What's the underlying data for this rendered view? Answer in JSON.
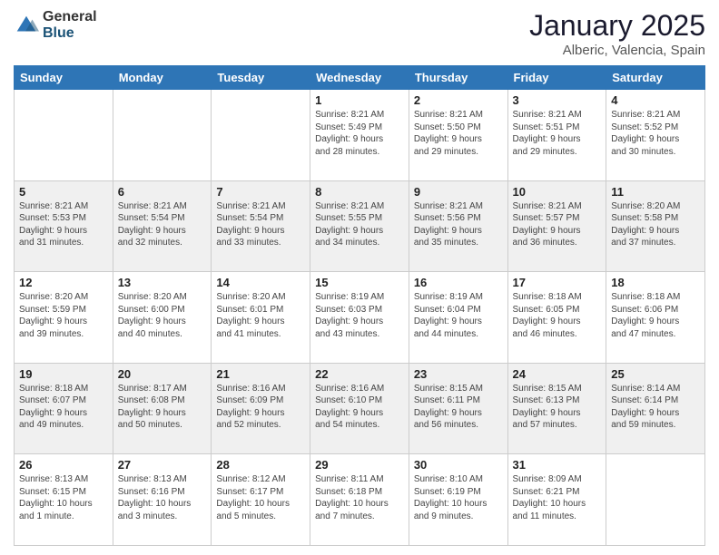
{
  "logo": {
    "general": "General",
    "blue": "Blue"
  },
  "title": "January 2025",
  "subtitle": "Alberic, Valencia, Spain",
  "days": [
    "Sunday",
    "Monday",
    "Tuesday",
    "Wednesday",
    "Thursday",
    "Friday",
    "Saturday"
  ],
  "weeks": [
    [
      {
        "day": "",
        "info": ""
      },
      {
        "day": "",
        "info": ""
      },
      {
        "day": "",
        "info": ""
      },
      {
        "day": "1",
        "info": "Sunrise: 8:21 AM\nSunset: 5:49 PM\nDaylight: 9 hours\nand 28 minutes."
      },
      {
        "day": "2",
        "info": "Sunrise: 8:21 AM\nSunset: 5:50 PM\nDaylight: 9 hours\nand 29 minutes."
      },
      {
        "day": "3",
        "info": "Sunrise: 8:21 AM\nSunset: 5:51 PM\nDaylight: 9 hours\nand 29 minutes."
      },
      {
        "day": "4",
        "info": "Sunrise: 8:21 AM\nSunset: 5:52 PM\nDaylight: 9 hours\nand 30 minutes."
      }
    ],
    [
      {
        "day": "5",
        "info": "Sunrise: 8:21 AM\nSunset: 5:53 PM\nDaylight: 9 hours\nand 31 minutes."
      },
      {
        "day": "6",
        "info": "Sunrise: 8:21 AM\nSunset: 5:54 PM\nDaylight: 9 hours\nand 32 minutes."
      },
      {
        "day": "7",
        "info": "Sunrise: 8:21 AM\nSunset: 5:54 PM\nDaylight: 9 hours\nand 33 minutes."
      },
      {
        "day": "8",
        "info": "Sunrise: 8:21 AM\nSunset: 5:55 PM\nDaylight: 9 hours\nand 34 minutes."
      },
      {
        "day": "9",
        "info": "Sunrise: 8:21 AM\nSunset: 5:56 PM\nDaylight: 9 hours\nand 35 minutes."
      },
      {
        "day": "10",
        "info": "Sunrise: 8:21 AM\nSunset: 5:57 PM\nDaylight: 9 hours\nand 36 minutes."
      },
      {
        "day": "11",
        "info": "Sunrise: 8:20 AM\nSunset: 5:58 PM\nDaylight: 9 hours\nand 37 minutes."
      }
    ],
    [
      {
        "day": "12",
        "info": "Sunrise: 8:20 AM\nSunset: 5:59 PM\nDaylight: 9 hours\nand 39 minutes."
      },
      {
        "day": "13",
        "info": "Sunrise: 8:20 AM\nSunset: 6:00 PM\nDaylight: 9 hours\nand 40 minutes."
      },
      {
        "day": "14",
        "info": "Sunrise: 8:20 AM\nSunset: 6:01 PM\nDaylight: 9 hours\nand 41 minutes."
      },
      {
        "day": "15",
        "info": "Sunrise: 8:19 AM\nSunset: 6:03 PM\nDaylight: 9 hours\nand 43 minutes."
      },
      {
        "day": "16",
        "info": "Sunrise: 8:19 AM\nSunset: 6:04 PM\nDaylight: 9 hours\nand 44 minutes."
      },
      {
        "day": "17",
        "info": "Sunrise: 8:18 AM\nSunset: 6:05 PM\nDaylight: 9 hours\nand 46 minutes."
      },
      {
        "day": "18",
        "info": "Sunrise: 8:18 AM\nSunset: 6:06 PM\nDaylight: 9 hours\nand 47 minutes."
      }
    ],
    [
      {
        "day": "19",
        "info": "Sunrise: 8:18 AM\nSunset: 6:07 PM\nDaylight: 9 hours\nand 49 minutes."
      },
      {
        "day": "20",
        "info": "Sunrise: 8:17 AM\nSunset: 6:08 PM\nDaylight: 9 hours\nand 50 minutes."
      },
      {
        "day": "21",
        "info": "Sunrise: 8:16 AM\nSunset: 6:09 PM\nDaylight: 9 hours\nand 52 minutes."
      },
      {
        "day": "22",
        "info": "Sunrise: 8:16 AM\nSunset: 6:10 PM\nDaylight: 9 hours\nand 54 minutes."
      },
      {
        "day": "23",
        "info": "Sunrise: 8:15 AM\nSunset: 6:11 PM\nDaylight: 9 hours\nand 56 minutes."
      },
      {
        "day": "24",
        "info": "Sunrise: 8:15 AM\nSunset: 6:13 PM\nDaylight: 9 hours\nand 57 minutes."
      },
      {
        "day": "25",
        "info": "Sunrise: 8:14 AM\nSunset: 6:14 PM\nDaylight: 9 hours\nand 59 minutes."
      }
    ],
    [
      {
        "day": "26",
        "info": "Sunrise: 8:13 AM\nSunset: 6:15 PM\nDaylight: 10 hours\nand 1 minute."
      },
      {
        "day": "27",
        "info": "Sunrise: 8:13 AM\nSunset: 6:16 PM\nDaylight: 10 hours\nand 3 minutes."
      },
      {
        "day": "28",
        "info": "Sunrise: 8:12 AM\nSunset: 6:17 PM\nDaylight: 10 hours\nand 5 minutes."
      },
      {
        "day": "29",
        "info": "Sunrise: 8:11 AM\nSunset: 6:18 PM\nDaylight: 10 hours\nand 7 minutes."
      },
      {
        "day": "30",
        "info": "Sunrise: 8:10 AM\nSunset: 6:19 PM\nDaylight: 10 hours\nand 9 minutes."
      },
      {
        "day": "31",
        "info": "Sunrise: 8:09 AM\nSunset: 6:21 PM\nDaylight: 10 hours\nand 11 minutes."
      },
      {
        "day": "",
        "info": ""
      }
    ]
  ]
}
